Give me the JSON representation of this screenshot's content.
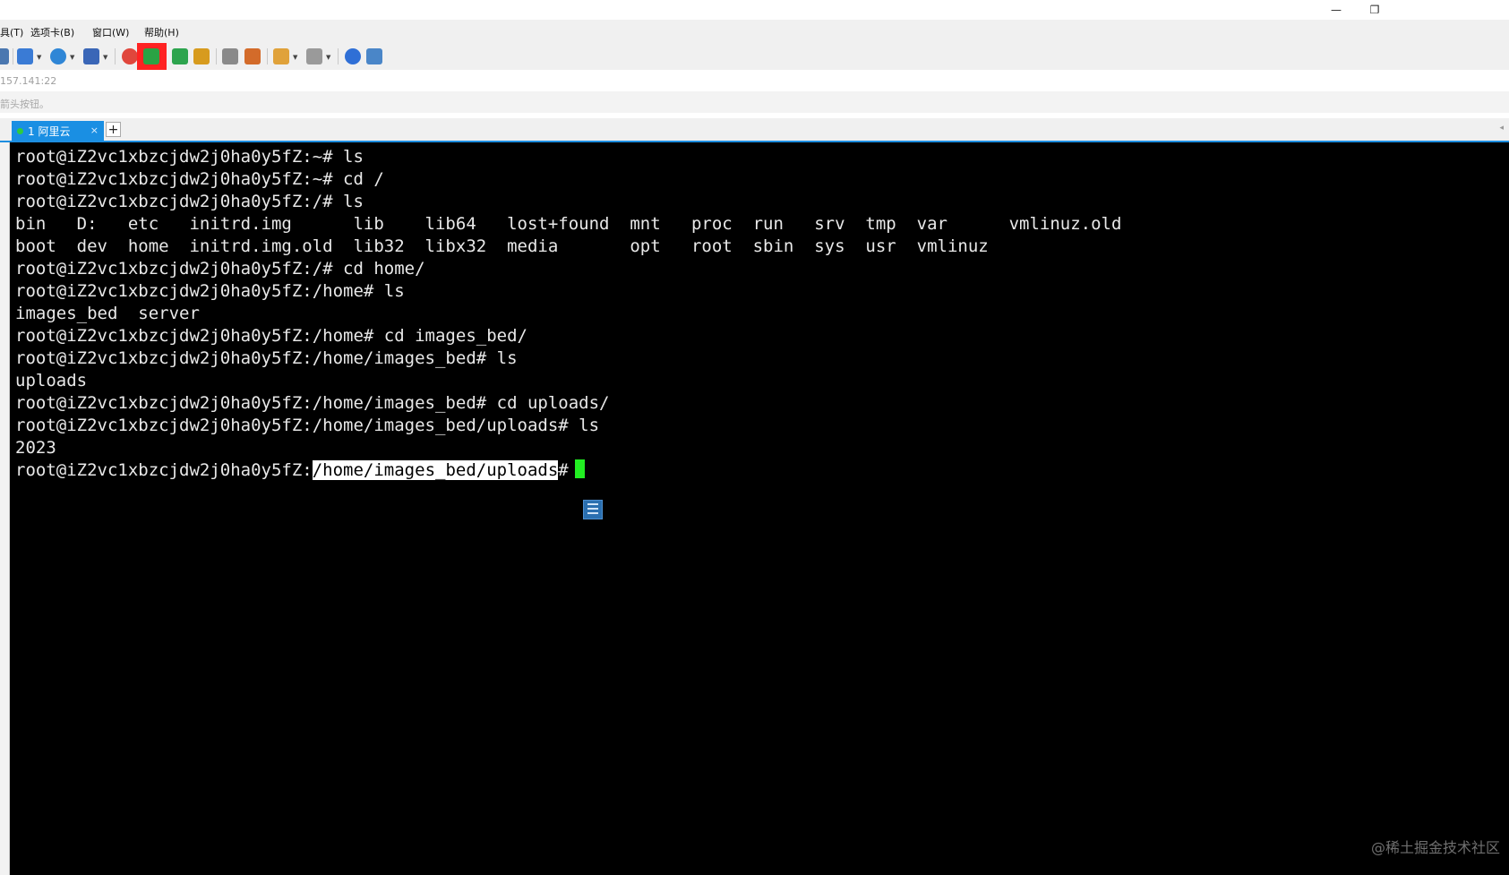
{
  "window": {
    "minimize_glyph": "—",
    "restore_glyph": "❐"
  },
  "menu": [
    {
      "label": "具(T)"
    },
    {
      "label": "选项卡(B)"
    },
    {
      "label": "窗口(W)"
    },
    {
      "label": "帮助(H)"
    }
  ],
  "toolbar": {
    "icons": [
      {
        "name": "partial-left-icon",
        "color": "#4a77b0"
      },
      {
        "name": "new-session-icon",
        "color": "#3a7bd5"
      },
      {
        "name": "globe-icon",
        "color": "#2f86d6"
      },
      {
        "name": "font-icon",
        "color": "#3a66b7"
      },
      {
        "name": "color-swirl-icon",
        "color": "#e0463c"
      },
      {
        "name": "new-file-transfer-icon",
        "color": "#2aa344"
      },
      {
        "name": "fullscreen-icon",
        "color": "#2da44e"
      },
      {
        "name": "lock-icon",
        "color": "#d79b1e"
      },
      {
        "name": "keyboard-icon",
        "color": "#8a8a8a"
      },
      {
        "name": "highlighter-icon",
        "color": "#d36b2a"
      },
      {
        "name": "folder-icon",
        "color": "#e0a23a"
      },
      {
        "name": "layout-icon",
        "color": "#9a9a9a"
      },
      {
        "name": "help-icon",
        "color": "#2f6fd6"
      },
      {
        "name": "chat-icon",
        "color": "#4a86c8"
      }
    ],
    "highlight_color": "#ff2222"
  },
  "address": {
    "text": "157.141:22"
  },
  "hint": {
    "text": "箭头按钮。"
  },
  "tabs": [
    {
      "label": "1 阿里云",
      "status_color": "#2ecc40",
      "close": "×"
    }
  ],
  "tab_add": "+",
  "tab_scroll": "◂",
  "terminal": {
    "lines": [
      "root@iZ2vc1xbzcjdw2j0ha0y5fZ:~# ls",
      "root@iZ2vc1xbzcjdw2j0ha0y5fZ:~# cd /",
      "root@iZ2vc1xbzcjdw2j0ha0y5fZ:/# ls",
      "bin   D:   etc   initrd.img      lib    lib64   lost+found  mnt   proc  run   srv  tmp  var      vmlinuz.old",
      "boot  dev  home  initrd.img.old  lib32  libx32  media       opt   root  sbin  sys  usr  vmlinuz",
      "root@iZ2vc1xbzcjdw2j0ha0y5fZ:/# cd home/",
      "root@iZ2vc1xbzcjdw2j0ha0y5fZ:/home# ls",
      "images_bed  server",
      "root@iZ2vc1xbzcjdw2j0ha0y5fZ:/home# cd images_bed/",
      "root@iZ2vc1xbzcjdw2j0ha0y5fZ:/home/images_bed# ls",
      "uploads",
      "root@iZ2vc1xbzcjdw2j0ha0y5fZ:/home/images_bed# cd uploads/",
      "root@iZ2vc1xbzcjdw2j0ha0y5fZ:/home/images_bed/uploads# ls",
      "2023"
    ],
    "prompt": {
      "host": "root@iZ2vc1xbzcjdw2j0ha0y5fZ:",
      "path_selected": "/home/images_bed/uploads",
      "suffix": "#"
    },
    "cursor_color": "#22ee22"
  },
  "watermark": "@稀土掘金技术社区"
}
